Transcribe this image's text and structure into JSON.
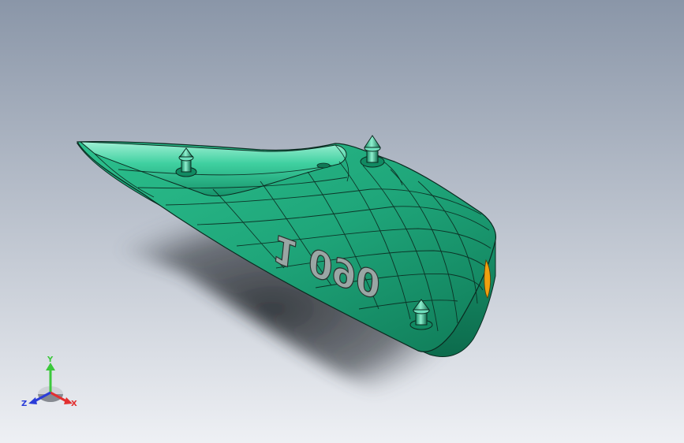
{
  "viewport": {
    "background_top": "#8a96a8",
    "background_bottom": "#eef0f4"
  },
  "model": {
    "body_color": "#1fa67a",
    "highlight_color": "#6fe0bd",
    "edge_color": "#0b2a20",
    "accent_color": "#f0a010",
    "emboss_text": "1 090",
    "emboss_color": "#9aa6a4"
  },
  "triad": {
    "x_label": "X",
    "y_label": "Y",
    "z_label": "Z",
    "x_color": "#e23030",
    "y_color": "#3cc83c",
    "z_color": "#2a3cd8"
  }
}
